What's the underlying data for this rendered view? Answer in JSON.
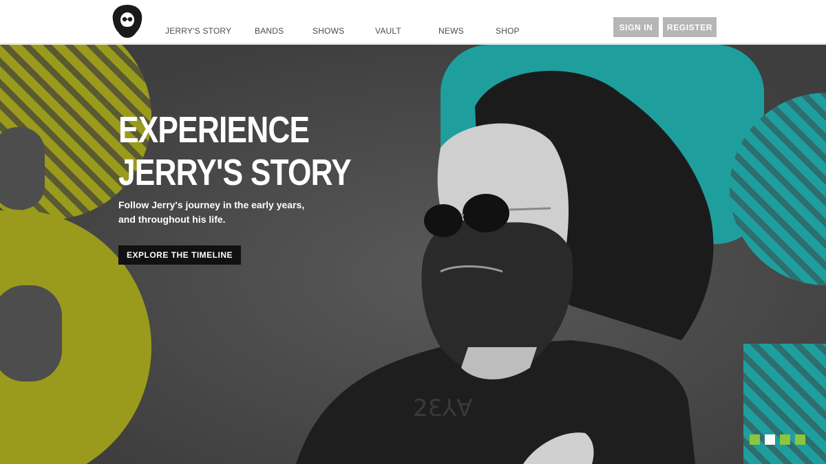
{
  "header": {
    "logo_icon": "bearded-portrait-logo-icon",
    "nav": [
      {
        "label": "JERRY'S STORY"
      },
      {
        "label": "BANDS"
      },
      {
        "label": "SHOWS"
      },
      {
        "label": "VAULT"
      },
      {
        "label": "NEWS"
      },
      {
        "label": "SHOP"
      }
    ],
    "sign_in_label": "SIGN IN",
    "register_label": "REGISTER"
  },
  "hero": {
    "title_line1": "EXPERIENCE",
    "title_line2": "JERRY'S STORY",
    "subtitle_line1": "Follow Jerry's journey in the early years,",
    "subtitle_line2": "and throughout his life.",
    "cta_label": "EXPLORE THE TIMELINE",
    "image": "black-and-white-portrait-bearded-man-sunglasses"
  },
  "carousel": {
    "slides": 4,
    "active_index": 1
  },
  "colors": {
    "hero_bg": "#4d4d4d",
    "olive_accent": "#9a9a1c",
    "teal_accent": "#1f9e9e",
    "nav_text": "#4a4a4a",
    "auth_button": "#b6b6b6",
    "dot_green": "#8cc63f",
    "dot_active": "#ffffff"
  }
}
